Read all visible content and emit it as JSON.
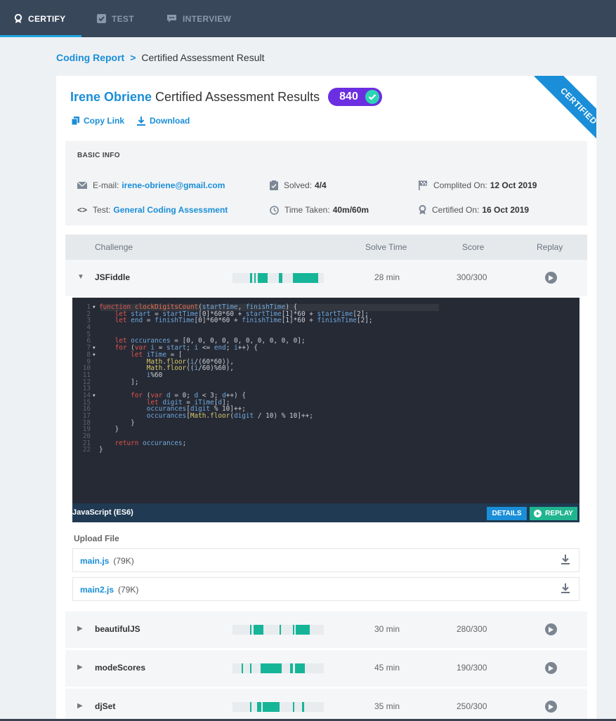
{
  "nav": {
    "tabs": [
      {
        "label": "CERTIFY",
        "active": true
      },
      {
        "label": "TEST",
        "active": false
      },
      {
        "label": "INTERVIEW",
        "active": false
      }
    ]
  },
  "breadcrumb": {
    "parent": "Coding Report",
    "separator": ">",
    "current": "Certified Assessment Result"
  },
  "header": {
    "name": "Irene Obriene",
    "title": "Certified Assessment Results",
    "score": "840",
    "ribbon": "CERTIFIED"
  },
  "actions": {
    "copy_link": "Copy Link",
    "download": "Download"
  },
  "basic_info": {
    "heading": "BASIC INFO",
    "email_label": "E-mail:",
    "email": "irene-obriene@gmail.com",
    "test_label": "Test:",
    "test": "General Coding Assessment",
    "solved_label": "Solved:",
    "solved": "4/4",
    "time_label": "Time Taken:",
    "time": "40m/60m",
    "completed_label": "Complited On:",
    "completed": "12 Oct 2019",
    "certified_label": "Certified On:",
    "certified": "16 Oct 2019"
  },
  "table": {
    "headers": {
      "challenge": "Challenge",
      "solve_time": "Solve Time",
      "score": "Score",
      "replay": "Replay"
    },
    "rows": [
      {
        "name": "JSFiddle",
        "solve_time": "28 min",
        "score": "300/300",
        "expanded": true
      },
      {
        "name": "beautifulJS",
        "solve_time": "30 min",
        "score": "280/300",
        "expanded": false
      },
      {
        "name": "modeScores",
        "solve_time": "45 min",
        "score": "190/300",
        "expanded": false
      },
      {
        "name": "djSet",
        "solve_time": "35 min",
        "score": "250/300",
        "expanded": false
      }
    ]
  },
  "editor": {
    "language": "JavaScript (ES6)",
    "details_label": "DETAILS",
    "replay_label": "REPLAY",
    "lines": [
      "function clockDigitsCount(startTime, finishTime) {",
      "    let start = startTime[0]*60*60 + startTime[1]*60 + startTime[2];",
      "    let end = finishTime[0]*60*60 + finishTime[1]*60 + finishTime[2];",
      "",
      "",
      "    let occurances = [0, 0, 0, 0, 0, 0, 0, 0, 0, 0];",
      "    for (var i = start; i <= end; i++) {",
      "        let iTime = [",
      "            Math.floor(i/(60*60)),",
      "            Math.floor((i/60)%60),",
      "            i%60",
      "        ];",
      "",
      "        for (var d = 0; d < 3; d++) {",
      "            let digit = iTime[d];",
      "            occurances[digit % 10]++;",
      "            occurances[Math.floor(digit / 10) % 10]++;",
      "        }",
      "    }",
      "",
      "    return occurances;",
      "}"
    ]
  },
  "upload": {
    "heading": "Upload File",
    "files": [
      {
        "name": "main.js",
        "size": "(79K)"
      },
      {
        "name": "main2.js",
        "size": "(79K)"
      }
    ]
  },
  "colors": {
    "nav_bg": "#39475a",
    "accent_blue": "#1a8ed8",
    "score_purple": "#6b2ee0",
    "bar_green": "#16b598",
    "editor_bg": "#262a35"
  }
}
